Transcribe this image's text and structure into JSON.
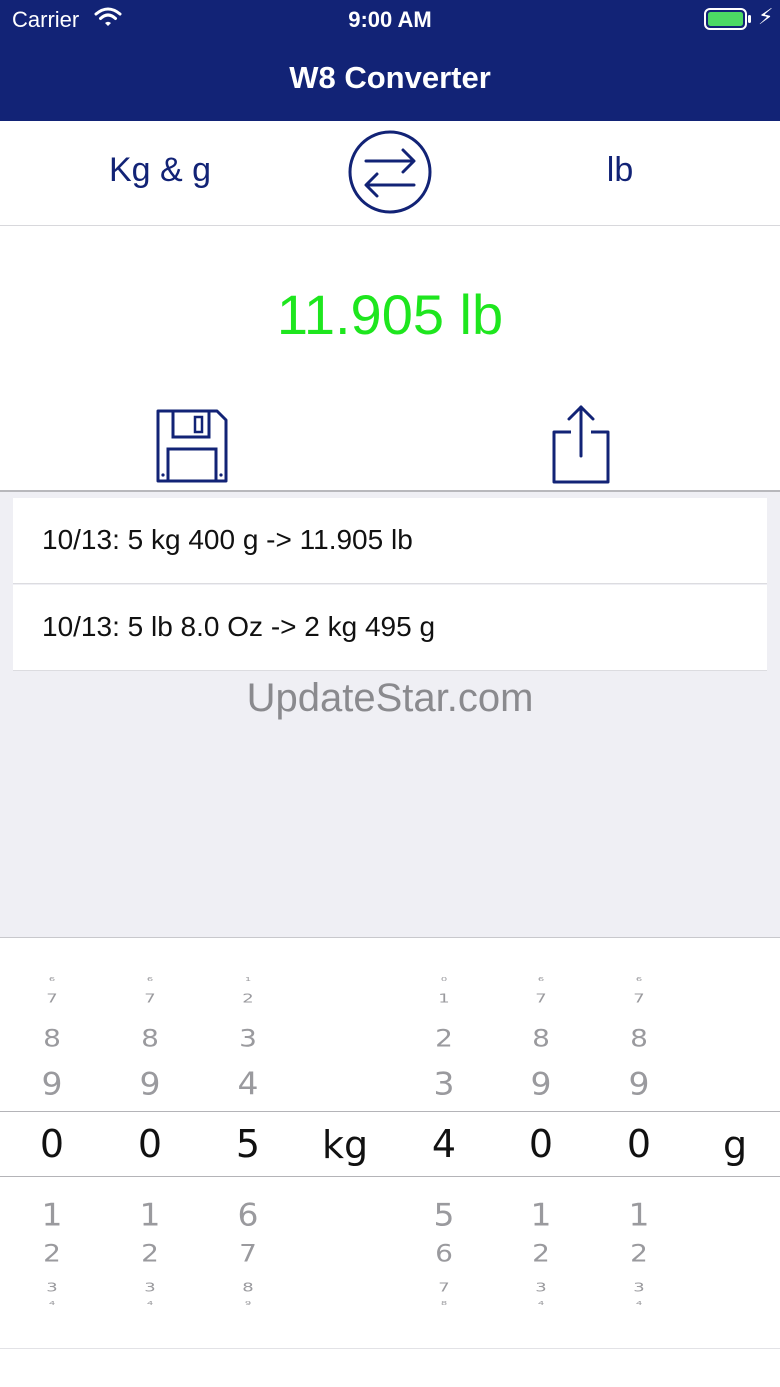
{
  "status_bar": {
    "carrier": "Carrier",
    "time": "9:00 AM"
  },
  "nav": {
    "title": "W8 Converter"
  },
  "units": {
    "from": "Kg & g",
    "to": "lb"
  },
  "result": "11.905 lb",
  "history": [
    "10/13: 5 kg 400 g -> 11.905 lb",
    "10/13: 5 lb 8.0 Oz -> 2 kg 495 g"
  ],
  "watermark": "UpdateStar.com",
  "picker": {
    "columns": [
      {
        "above": [
          "6",
          "7",
          "8",
          "9"
        ],
        "selected": "0",
        "below": [
          "1",
          "2",
          "3",
          "4"
        ]
      },
      {
        "above": [
          "6",
          "7",
          "8",
          "9"
        ],
        "selected": "0",
        "below": [
          "1",
          "2",
          "3",
          "4"
        ]
      },
      {
        "above": [
          "1",
          "2",
          "3",
          "4"
        ],
        "selected": "5",
        "below": [
          "6",
          "7",
          "8",
          "9"
        ]
      },
      {
        "above": [
          "0",
          "1",
          "2",
          "3"
        ],
        "selected": "4",
        "below": [
          "5",
          "6",
          "7",
          "8"
        ]
      },
      {
        "above": [
          "6",
          "7",
          "8",
          "9"
        ],
        "selected": "0",
        "below": [
          "1",
          "2",
          "3",
          "4"
        ]
      },
      {
        "above": [
          "6",
          "7",
          "8",
          "9"
        ],
        "selected": "0",
        "below": [
          "1",
          "2",
          "3",
          "4"
        ]
      }
    ],
    "unit_kg": "kg",
    "unit_g": "g"
  },
  "colors": {
    "nav": "#122376",
    "accent": "#122376",
    "result": "#1ee61e"
  }
}
